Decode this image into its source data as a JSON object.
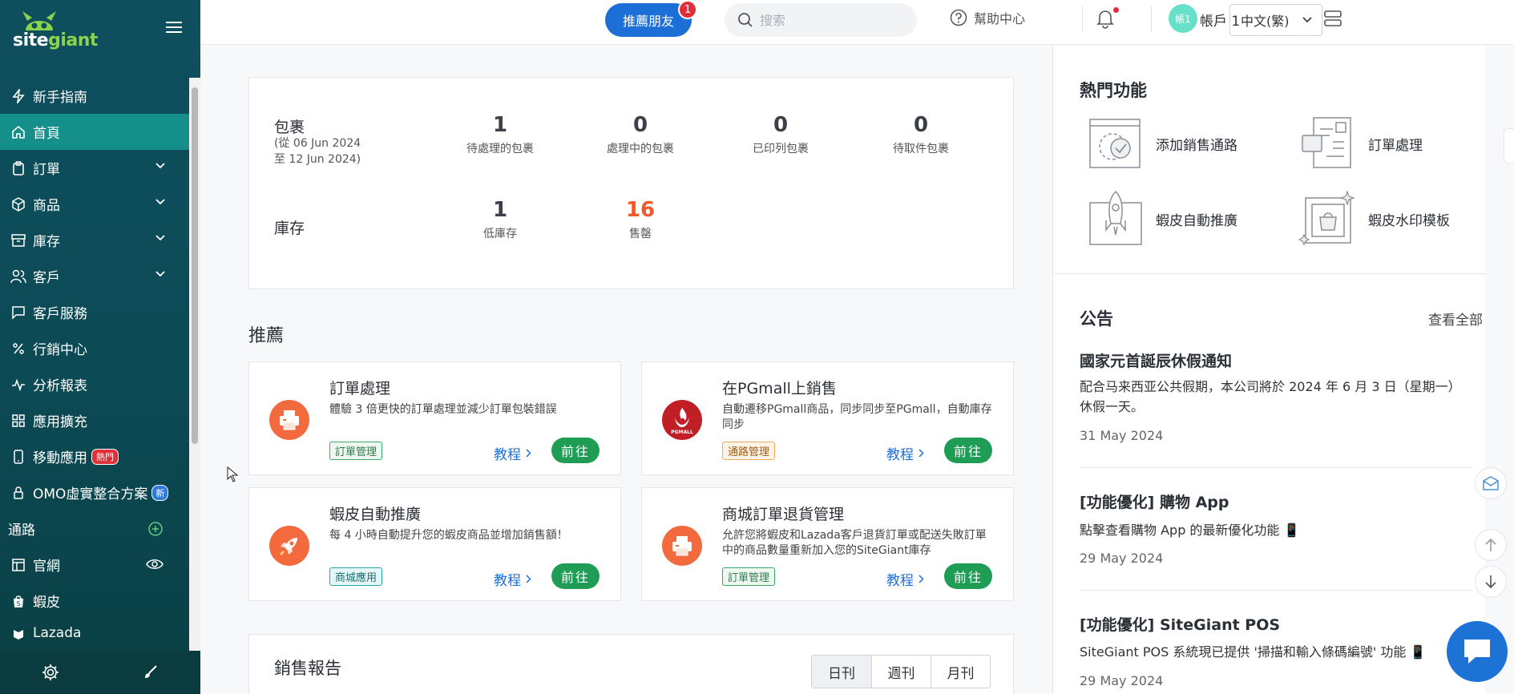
{
  "sidebar": {
    "logo_text_a": "site",
    "logo_text_b": "giant",
    "items": [
      {
        "label": "新手指南",
        "icon": "lightning-icon"
      },
      {
        "label": "首頁",
        "icon": "home-icon",
        "active": true
      },
      {
        "label": "訂單",
        "icon": "clipboard-icon",
        "expandable": true
      },
      {
        "label": "商品",
        "icon": "box-icon",
        "expandable": true
      },
      {
        "label": "庫存",
        "icon": "archive-icon",
        "expandable": true
      },
      {
        "label": "客戶",
        "icon": "users-icon",
        "expandable": true
      },
      {
        "label": "客戶服務",
        "icon": "chat-icon"
      },
      {
        "label": "行銷中心",
        "icon": "percent-icon"
      },
      {
        "label": "分析報表",
        "icon": "pulse-icon"
      },
      {
        "label": "應用擴充",
        "icon": "grid-icon"
      },
      {
        "label": "移動應用",
        "icon": "mobile-icon",
        "badge": "熱門"
      },
      {
        "label": "OMO虛實整合方案",
        "icon": "lock-icon",
        "badge": "新"
      }
    ],
    "channels_label": "通路",
    "channels": [
      {
        "label": "官網",
        "icon": "layout-icon"
      },
      {
        "label": "蝦皮",
        "icon": "shopee-icon"
      },
      {
        "label": "Lazada",
        "icon": "lazada-icon"
      }
    ]
  },
  "topbar": {
    "recommend_label": "推薦朋友",
    "recommend_count": "1",
    "search_placeholder": "搜索",
    "help_label": "幫助中心",
    "language": "中文(繁)",
    "avatar_text": "帳1",
    "account_label": "帳戶 1"
  },
  "packages": {
    "title": "包裹",
    "range_line1": "(從 06 Jun 2024",
    "range_line2": "至 12 Jun 2024)",
    "stats": [
      {
        "value": "1",
        "label": "待處理的包裹"
      },
      {
        "value": "0",
        "label": "處理中的包裹"
      },
      {
        "value": "0",
        "label": "已印列包裹"
      },
      {
        "value": "0",
        "label": "待取件包裹"
      }
    ]
  },
  "inventory": {
    "title": "庫存",
    "stats": [
      {
        "value": "1",
        "label": "低庫存"
      },
      {
        "value": "16",
        "label": "售罄"
      }
    ]
  },
  "recommend": {
    "title": "推薦",
    "tutorial_label": "教程",
    "go_label": "前往",
    "cards": [
      {
        "title": "訂單處理",
        "desc": "體驗 3 倍更快的訂單處理並減少訂單包裝錯誤",
        "tag": "訂單管理"
      },
      {
        "title": "在PGmall上銷售",
        "desc": "自動遷移PGmall商品，同步同步至PGmall，自動庫存同步",
        "tag": "通路管理"
      },
      {
        "title": "蝦皮自動推廣",
        "desc": "每 4 小時自動提升您的蝦皮商品並增加銷售額！",
        "tag": "商城應用"
      },
      {
        "title": "商城訂單退貨管理",
        "desc": "允許您將蝦皮和Lazada客戶退貨訂單或配送失敗訂單中的商品數量重新加入您的SiteGiant庫存",
        "tag": "訂單管理"
      }
    ],
    "pgmall_logo_text": "PGMALL"
  },
  "sales": {
    "title": "銷售報告",
    "periods": [
      "日刊",
      "週刊",
      "月刊"
    ]
  },
  "hot_features": {
    "title": "熱門功能",
    "items": [
      "添加銷售通路",
      "訂單處理",
      "蝦皮自動推廣",
      "蝦皮水印模板"
    ]
  },
  "announcements": {
    "title": "公告",
    "view_all": "查看全部",
    "items": [
      {
        "title": "國家元首誕辰休假通知",
        "body": "配合马来西亚公共假期，本公司將於 2024 年 6 月 3 日（星期一）休假一天。",
        "date": "31 May 2024"
      },
      {
        "title": "[功能優化] 購物 App",
        "body": "點擊查看購物 App 的最新優化功能 📱",
        "date": "29 May 2024"
      },
      {
        "title": "[功能優化] SiteGiant POS",
        "body": "SiteGiant POS 系統現已提供 '掃描和輸入條碼編號' 功能 📱",
        "date": "29 May 2024"
      }
    ]
  },
  "colors": {
    "sidebar": "#0e4f5e",
    "active": "#148f89",
    "primary": "#1d6fd8",
    "go": "#1f9d55",
    "sold_out": "#f05a28"
  }
}
